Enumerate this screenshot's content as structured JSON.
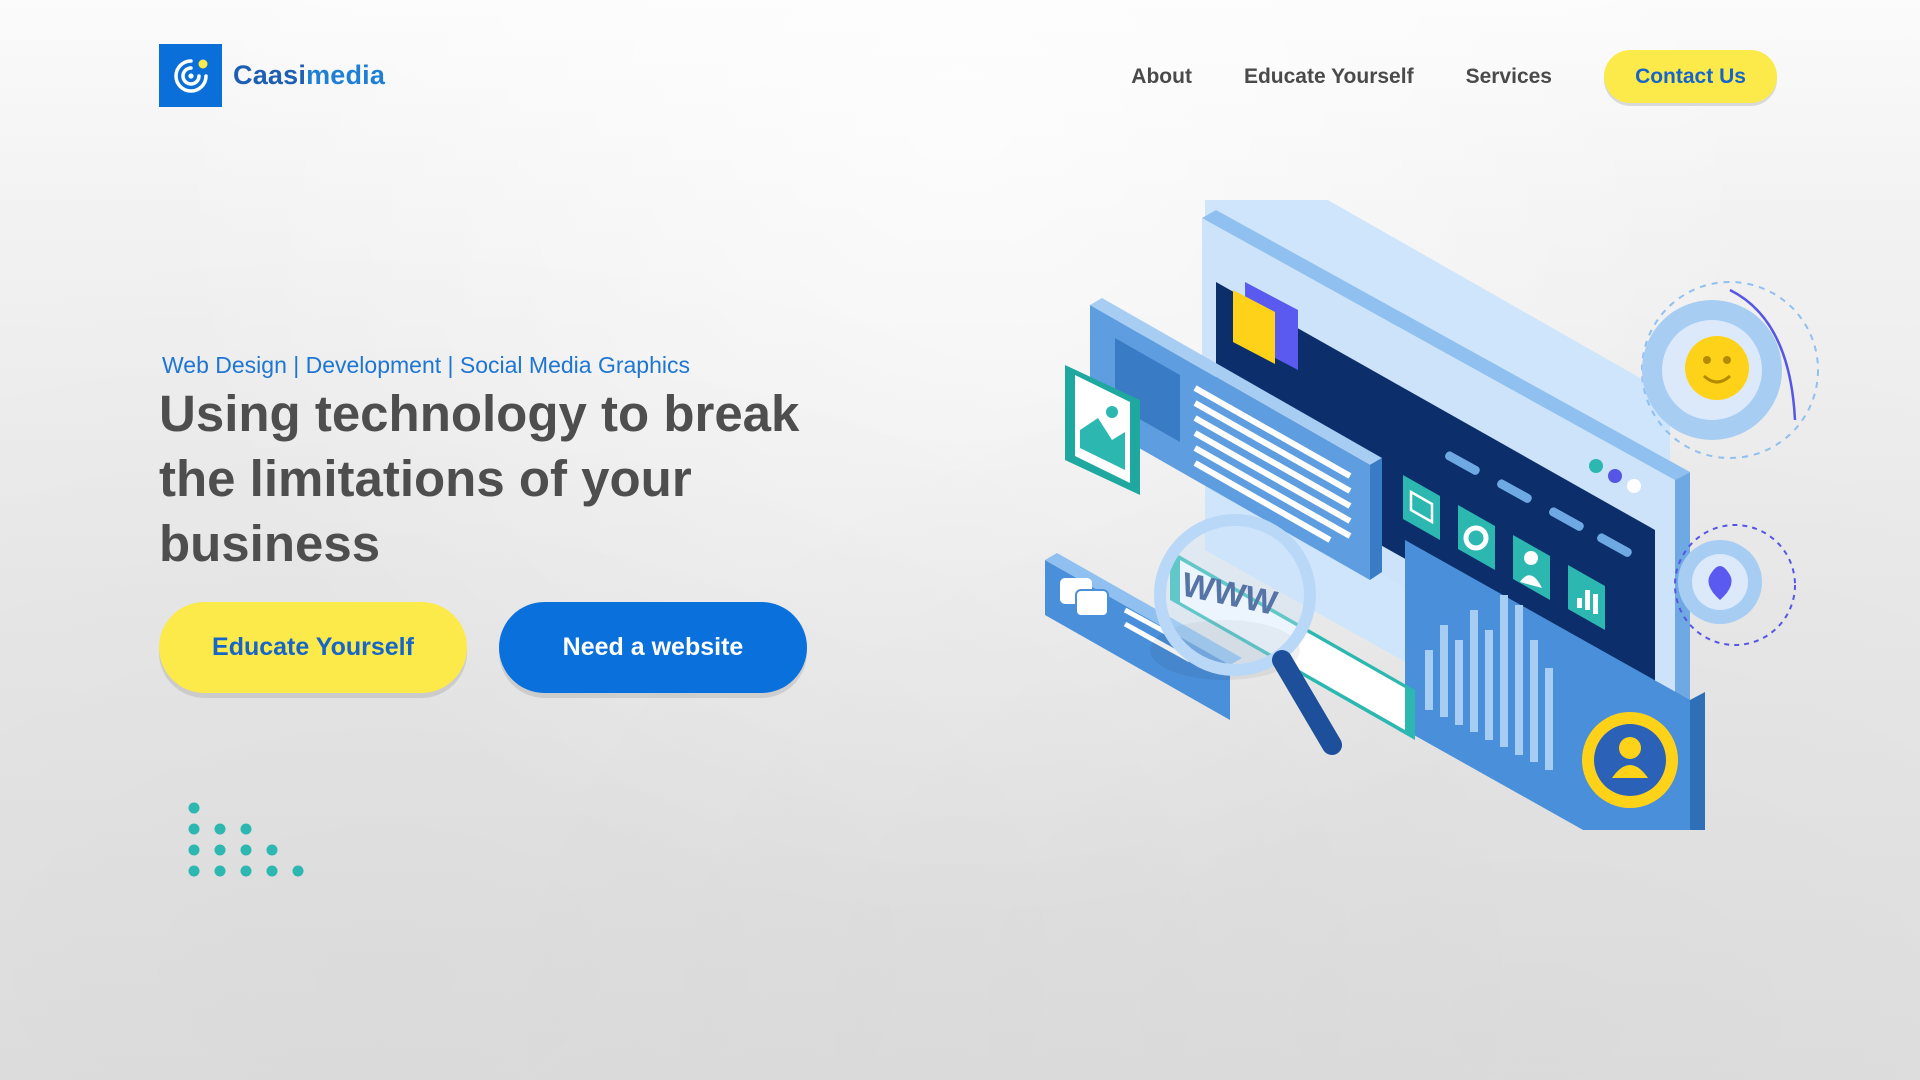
{
  "brand": {
    "name_bold": "Caasi",
    "name_light": "media",
    "icon": "caasimedia-logo-icon",
    "color": "#0a6fd8"
  },
  "nav": {
    "items": [
      {
        "label": "About"
      },
      {
        "label": "Educate Yourself"
      },
      {
        "label": "Services"
      }
    ],
    "cta_label": "Contact Us"
  },
  "hero": {
    "tagline": "Web Design | Development | Social Media Graphics",
    "headline": "Using technology to break the limitations of your business",
    "primary_button": "Educate Yourself",
    "secondary_button": "Need a website"
  },
  "illustration": {
    "www_label": "WWW",
    "icons": [
      "image-icon",
      "chat-icon",
      "magnifier-icon",
      "mail-icon",
      "gear-icon",
      "user-icon",
      "bar-chart-icon",
      "smiley-icon",
      "heart-icon"
    ]
  },
  "colors": {
    "accent_yellow": "#fce94a",
    "accent_blue": "#0a70dc",
    "text_dark": "#4e4e4e",
    "teal": "#2cb8b0"
  }
}
